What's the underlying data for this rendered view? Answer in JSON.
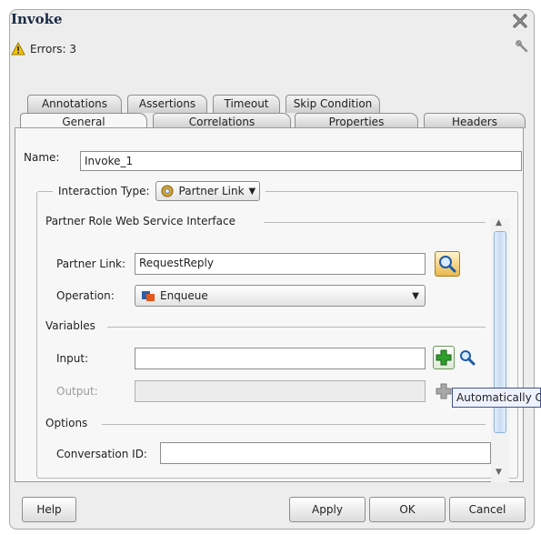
{
  "dialog": {
    "title": "Invoke",
    "errors_text": "Errors: 3"
  },
  "tabs_top": [
    {
      "label": "Annotations"
    },
    {
      "label": "Assertions"
    },
    {
      "label": "Timeout"
    },
    {
      "label": "Skip Condition"
    }
  ],
  "tabs_bottom": [
    {
      "label": "General",
      "active": true
    },
    {
      "label": "Correlations"
    },
    {
      "label": "Properties"
    },
    {
      "label": "Headers"
    }
  ],
  "general": {
    "name_label": "Name:",
    "name_value": "Invoke_1",
    "interaction_type_label": "Interaction Type:",
    "interaction_type_value": "Partner Link",
    "partner_role_section": "Partner Role Web Service Interface",
    "partner_link_label": "Partner Link:",
    "partner_link_value": "RequestReply",
    "operation_label": "Operation:",
    "operation_value": "Enqueue",
    "variables_section": "Variables",
    "input_label": "Input:",
    "input_value": "",
    "output_label": "Output:",
    "output_value": "",
    "options_section": "Options",
    "conversation_id_label": "Conversation ID:",
    "conversation_id_value": ""
  },
  "tooltip": "Automatically Create Output Variable",
  "buttons": {
    "help": "Help",
    "apply": "Apply",
    "ok": "OK",
    "cancel": "Cancel"
  },
  "colors": {
    "accent_blue": "#2a5fa8",
    "add_green": "#2e9e2a",
    "warning_yellow": "#f5c400"
  }
}
